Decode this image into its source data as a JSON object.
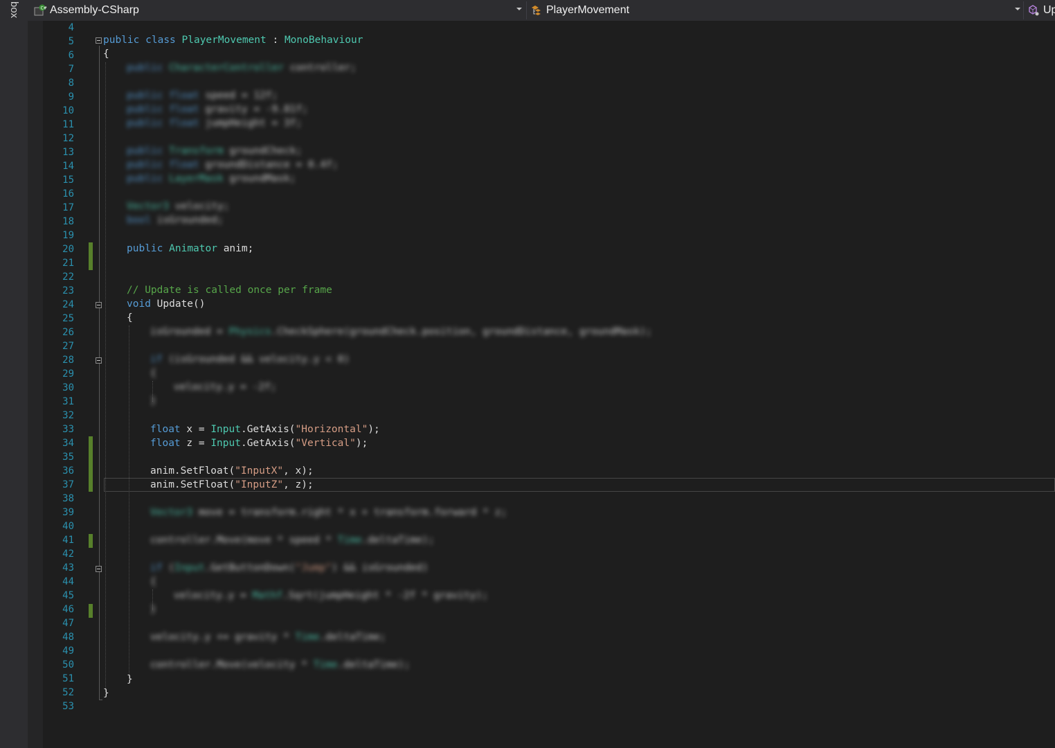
{
  "toolbox": {
    "label": "box"
  },
  "nav": {
    "project": "Assembly-CSharp",
    "type": "PlayerMovement",
    "member": "Up",
    "project_icon": "csharp-project-icon",
    "type_icon": "class-icon",
    "member_icon": "method-icon"
  },
  "colors": {
    "keyword": "#569cd6",
    "type": "#4ec9b0",
    "comment": "#57a64a",
    "string": "#d69d85",
    "line_number": "#2b91af",
    "change_bar": "#57802b"
  },
  "line_numbers": [
    "4",
    "5",
    "6",
    "7",
    "8",
    "9",
    "10",
    "11",
    "12",
    "13",
    "14",
    "15",
    "16",
    "17",
    "18",
    "19",
    "20",
    "21",
    "22",
    "23",
    "24",
    "25",
    "26",
    "27",
    "28",
    "29",
    "30",
    "31",
    "32",
    "33",
    "34",
    "35",
    "36",
    "37",
    "38",
    "39",
    "40",
    "41",
    "42",
    "43",
    "44",
    "45",
    "46",
    "47",
    "48",
    "49",
    "50",
    "51",
    "52",
    "53"
  ],
  "code": {
    "l5": {
      "kw1": "public",
      "kw2": "class",
      "name": "PlayerMovement",
      "sep": " : ",
      "base": "MonoBehaviour"
    },
    "l6": {
      "text": "{"
    },
    "l7": {
      "kw": "public",
      "type": "CharacterController",
      "rest": " controller;"
    },
    "l9": {
      "kw": "public",
      "type": "float",
      "rest": " speed = 12f;"
    },
    "l10": {
      "kw": "public",
      "type": "float",
      "rest": " gravity = -9.81f;"
    },
    "l11": {
      "kw": "public",
      "type": "float",
      "rest": " jumpHeight = 3f;"
    },
    "l13": {
      "kw": "public",
      "type": "Transform",
      "rest": " groundCheck;"
    },
    "l14": {
      "kw": "public",
      "type": "float",
      "rest": " groundDistance = 0.4f;"
    },
    "l15": {
      "kw": "public",
      "type": "LayerMask",
      "rest": " groundMask;"
    },
    "l17": {
      "type": "Vector3",
      "rest": " velocity;"
    },
    "l18": {
      "kw": "bool",
      "rest": " isGrounded;"
    },
    "l20": {
      "kw": "public",
      "type": "Animator",
      "rest": " anim;"
    },
    "l23": {
      "text": "// Update is called once per frame"
    },
    "l24": {
      "kw": "void",
      "name": "Update",
      "rest": "()"
    },
    "l25": {
      "text": "{"
    },
    "l26": {
      "pre": "isGrounded = ",
      "type": "Physics",
      "rest": ".CheckSphere(groundCheck.position, groundDistance, groundMask);"
    },
    "l28": {
      "kw": "if",
      "rest": " (isGrounded && velocity.y < 0)"
    },
    "l29": {
      "text": "{"
    },
    "l30": {
      "text": "velocity.y = -2f;"
    },
    "l31": {
      "text": "}"
    },
    "l33": {
      "kw": "float",
      "mid": " x = ",
      "type": "Input",
      "call": ".GetAxis(",
      "str": "\"Horizontal\"",
      "end": ");"
    },
    "l34": {
      "kw": "float",
      "mid": " z = ",
      "type": "Input",
      "call": ".GetAxis(",
      "str": "\"Vertical\"",
      "end": ");"
    },
    "l36": {
      "pre": "anim.SetFloat(",
      "str": "\"InputX\"",
      "end": ", x);"
    },
    "l37": {
      "pre": "anim.SetFloat(",
      "str": "\"InputZ\"",
      "end": ", z);"
    },
    "l39": {
      "type": "Vector3",
      "rest": " move = transform.right * x + transform.forward * z;"
    },
    "l41": {
      "pre": "controller.Move(move * speed * ",
      "type": "Time",
      "rest": ".deltaTime);"
    },
    "l43": {
      "kw": "if",
      "pre": " (",
      "type": "Input",
      "call": ".GetButtonDown(",
      "str": "\"Jump\"",
      "end": ") && isGrounded)"
    },
    "l44": {
      "text": "{"
    },
    "l45": {
      "pre": "velocity.y = ",
      "type": "Mathf",
      "rest": ".Sqrt(jumpHeight * -2f * gravity);"
    },
    "l46": {
      "text": "}"
    },
    "l48": {
      "pre": "velocity.y += gravity * ",
      "type": "Time",
      "rest": ".deltaTime;"
    },
    "l50": {
      "pre": "controller.Move(velocity * ",
      "type": "Time",
      "rest": ".deltaTime);"
    },
    "l51": {
      "text": "}"
    },
    "l52": {
      "text": "}"
    }
  }
}
